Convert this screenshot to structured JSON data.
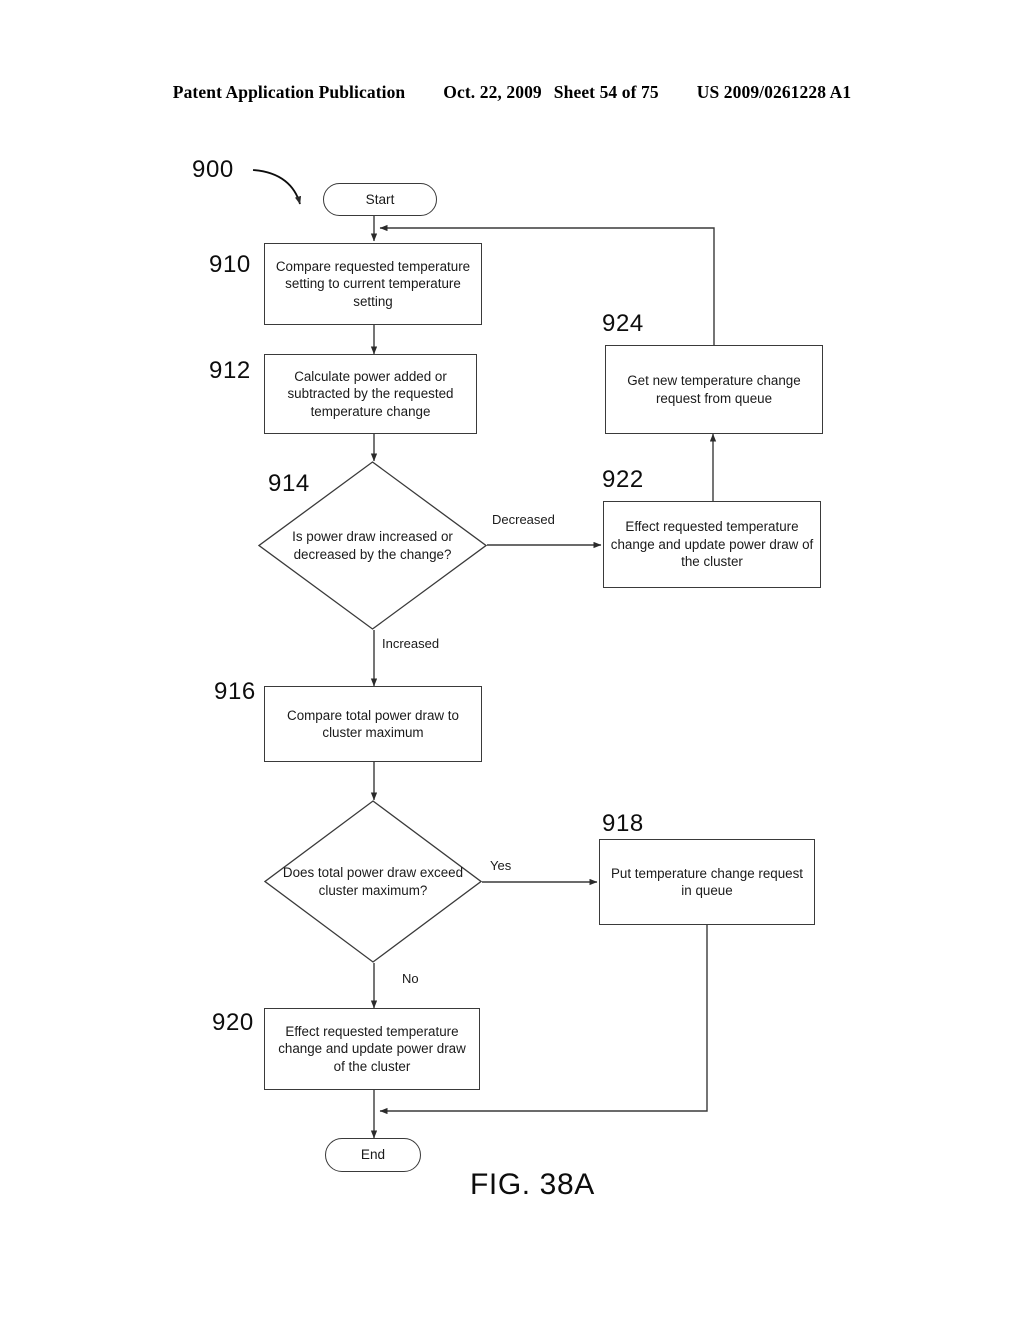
{
  "header": {
    "publication": "Patent Application Publication",
    "date": "Oct. 22, 2009",
    "sheet": "Sheet 54 of 75",
    "patent_number": "US 2009/0261228 A1"
  },
  "figure": {
    "caption": "FIG. 38A",
    "diagram_reference": "900"
  },
  "nodes": {
    "start": {
      "ref": "",
      "label": "Start"
    },
    "n910": {
      "ref": "910",
      "label": "Compare requested temperature setting to current temperature setting"
    },
    "n912": {
      "ref": "912",
      "label": "Calculate power added or subtracted by the requested temperature change"
    },
    "n914": {
      "ref": "914",
      "label": "Is power draw increased or decreased by the change?"
    },
    "n916": {
      "ref": "916",
      "label": "Compare total power draw to cluster maximum"
    },
    "n917": {
      "ref": "",
      "label": "Does total power draw exceed cluster maximum?"
    },
    "n918": {
      "ref": "918",
      "label": "Put temperature change request in queue"
    },
    "n920": {
      "ref": "920",
      "label": "Effect requested temperature change and update power draw of the cluster"
    },
    "n922": {
      "ref": "922",
      "label": "Effect requested temperature change and update power draw of the cluster"
    },
    "n924": {
      "ref": "924",
      "label": "Get new temperature change request from queue"
    },
    "end": {
      "ref": "",
      "label": "End"
    }
  },
  "edge_labels": {
    "decreased": "Decreased",
    "increased": "Increased",
    "yes": "Yes",
    "no": "No"
  },
  "colors": {
    "ink": "#000000",
    "line": "#3a3a3a",
    "page": "#ffffff"
  }
}
